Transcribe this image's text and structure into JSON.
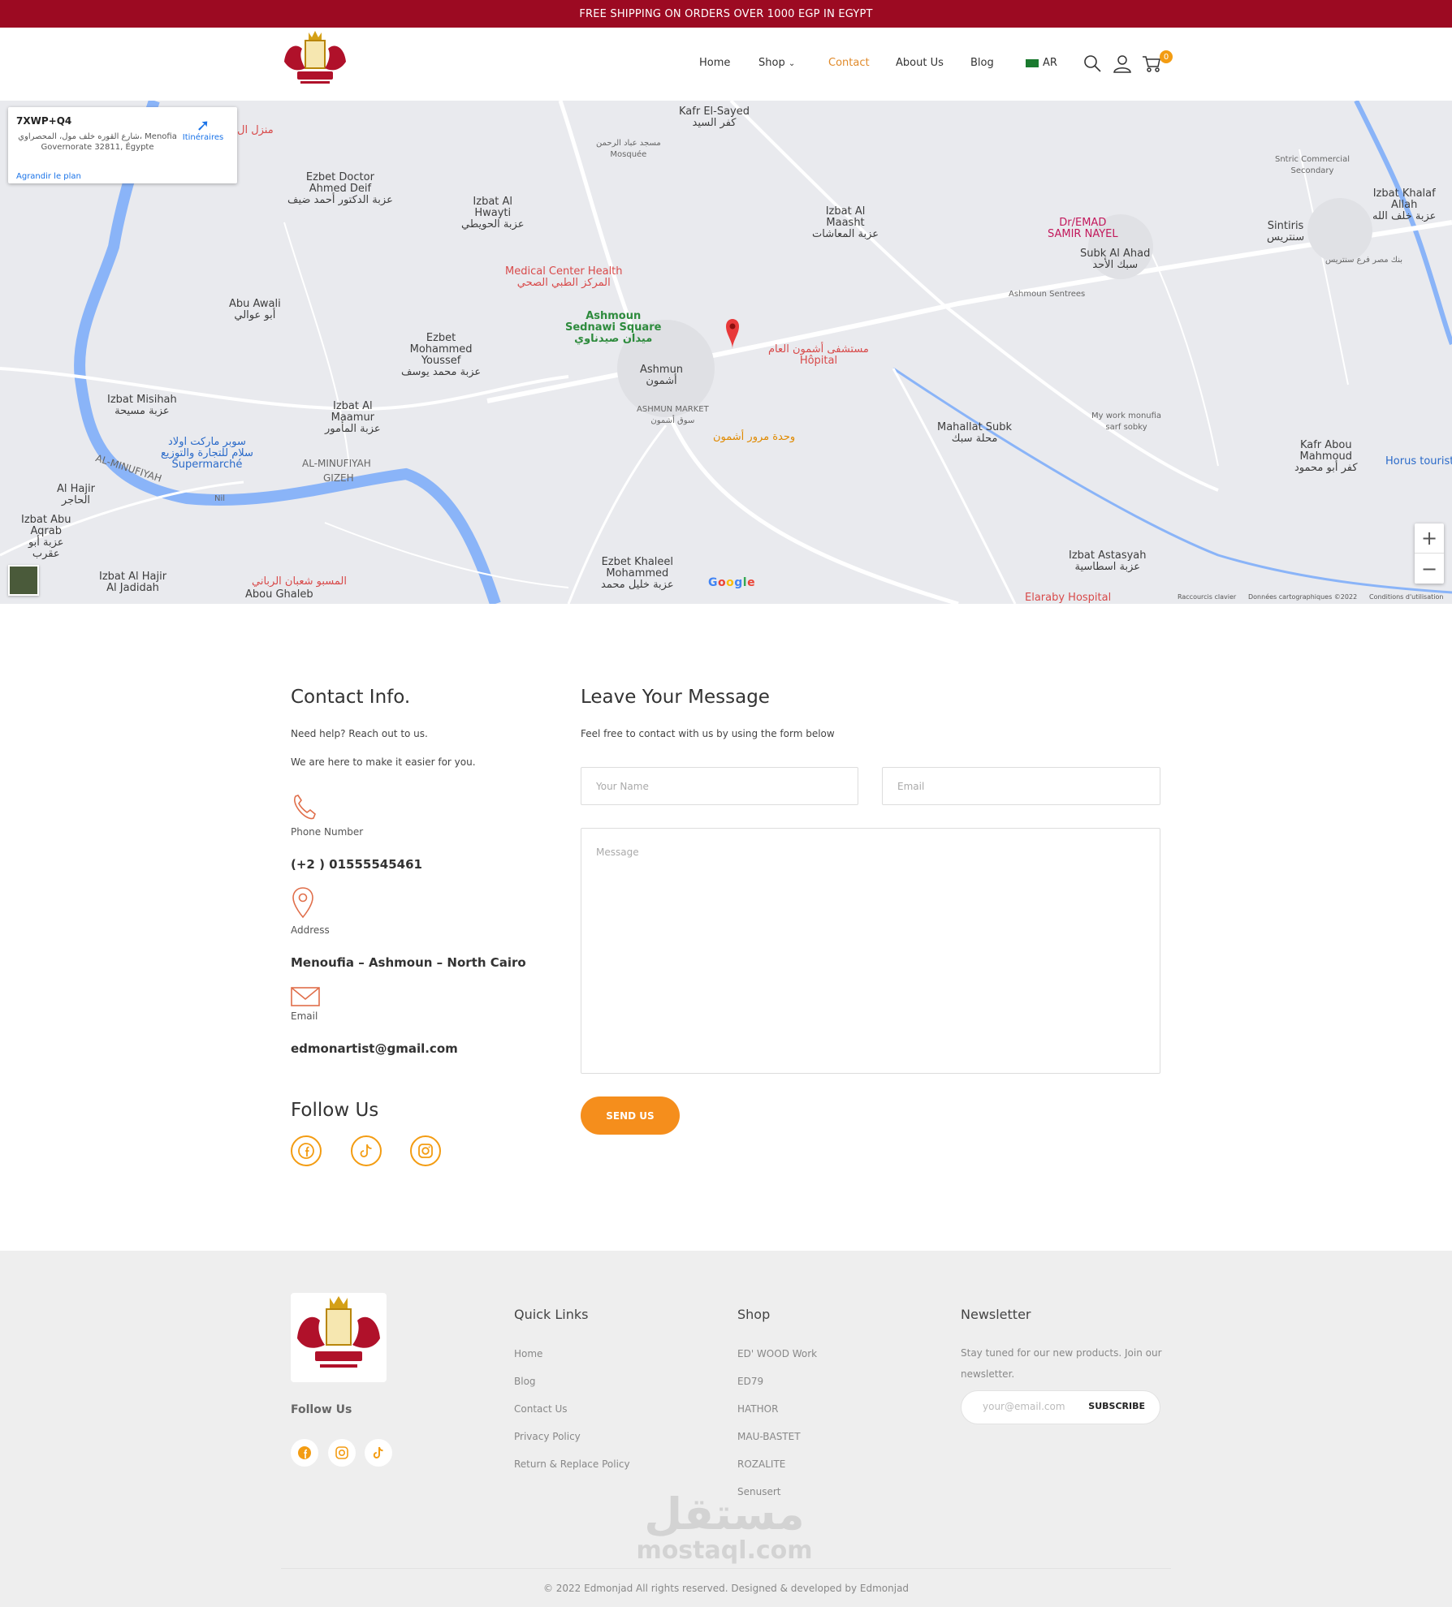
{
  "topbar": {
    "text": "FREE SHIPPING ON ORDERS OVER 1000 EGP IN EGYPT"
  },
  "brand": {
    "accent": "#f39c12",
    "primary": "#9c0a22"
  },
  "nav": {
    "home": "Home",
    "shop": "Shop",
    "contact": "Contact",
    "about": "About Us",
    "blog": "Blog",
    "lang": "AR",
    "cart_count": "0"
  },
  "map": {
    "plus_code": "7XWP+Q4",
    "address": "شارع القوره خلف مول، المحصراوي، Menofia Governorate 32811, Égypte",
    "directions": "Itinéraires",
    "enlarge": "Agrandir le plan",
    "shortcuts": "Raccourcis clavier",
    "mapdata": "Données cartographiques ©2022",
    "terms": "Conditions d'utilisation",
    "labels": {
      "kafr_sayed": "Kafr El-Sayed",
      "kafr_sayed_ar": "كفر السيد",
      "mosque": "مسجد عباد الرحمن",
      "mosque_sub": "Mosquée",
      "ezbet_doctor": "Ezbet Doctor Ahmed Deif",
      "ezbet_doctor_ar": "عزبة الدكتور أحمد ضيف",
      "hwayti": "Izbat Al Hwayti",
      "hwayti_ar": "عزبة الحويطي",
      "maasht": "Izbat Al Maasht",
      "maasht_ar": "عزبة المعاشات",
      "medical": "Medical Center Health",
      "medical_ar": "المركز الطبي الصحي",
      "ashmoun_sq": "Ashmoun Sednawi Square",
      "ashmoun_sq_ar": "ميدان صيدناوي",
      "ashmun": "Ashmun",
      "ashmun_ar": "أشمون",
      "hospital_ar": "مستشفى أشمون العام",
      "hospital_sub": "Hôpital",
      "abu_awali": "Abu Awali",
      "abu_awali_ar": "أبو عوالي",
      "ezbet_mohammed": "Ezbet Mohammed Youssef",
      "ezbet_mohammed_ar": "عزبة محمد يوسف",
      "misihah": "Izbat Misihah",
      "misihah_ar": "عزبة مسيحة",
      "maamur": "Izbat Al Maamur",
      "maamur_ar": "عزبة المأمور",
      "market": "ASHMUN MARKET",
      "market_ar": "سوق أشمون",
      "traffic_ar": "وحدة مرور أشمون",
      "mahallat": "Mahallat Subk",
      "mahallat_ar": "محلة سبك",
      "supermarket_ar": "سوبر ماركت اولاد سلام للتجارة والتوزيع",
      "supermarket_sub": "Supermarché",
      "minufiyah": "AL-MINUFIYAH",
      "gizeh": "GIZEH",
      "nil": "Nil",
      "hajir": "Al Hajir",
      "hajir_ar": "الحاجر",
      "abu_aqrab": "Izbat Abu Aqrab",
      "abu_aqrab_ar": "عزبة أبو عقرب",
      "hajir_jadidah": "Izbat Al Hajir Al Jadidah",
      "abou_ghaleb": "Abou Ghaleb",
      "abou_ghaleb_ar": "المسبو شعبان الرباني",
      "khaleel": "Ezbet Khaleel Mohammed",
      "khaleel_ar": "عزبة خليل محمد",
      "astasyah": "Izbat Astasyah",
      "astasyah_ar": "عزبة اسطاسية",
      "elaraby": "Elaraby Hospital",
      "samir": "Dr/EMAD SAMIR NAYEL",
      "subk": "Subk Al Ahad",
      "subk_ar": "سبك الأحد",
      "sintiris": "Sintiris",
      "sintiris_ar": "سنتريس",
      "sntric": "Sntric Commercial Secondary",
      "khalaf": "Izbat Khalaf Allah",
      "khalaf_ar": "عزبة خلف الله",
      "work": "My work monufia sarf sobky",
      "kafr_abou": "Kafr Abou Mahmoud",
      "kafr_abou_ar": "كفر أبو محمود",
      "horus": "Horus tourist",
      "sentrees": "Ashmoun Sentrees",
      "bank_ar": "بنك مصر فرع سنتريس",
      "manzil_ar": "منزل ال"
    }
  },
  "contact_info": {
    "title": "Contact Info.",
    "line1": "Need help? Reach out to us.",
    "line2": "We are here to make it easier for you.",
    "phone_label": "Phone Number",
    "phone": "(+2 ) 01555545461",
    "address_label": "Address",
    "address": "Menoufia – Ashmoun – North Cairo",
    "email_label": "Email",
    "email": "edmonartist@gmail.com",
    "follow": "Follow Us"
  },
  "message_form": {
    "title": "Leave Your Message",
    "subtitle": "Feel free to contact with us by using the form below",
    "name_placeholder": "Your Name",
    "email_placeholder": "Email",
    "message_placeholder": "Message",
    "send": "SEND US"
  },
  "footer": {
    "follow": "Follow Us",
    "quick_links_title": "Quick Links",
    "quick_links": [
      "Home",
      "Blog",
      "Contact Us",
      "Privacy Policy",
      "Return & Replace Policy"
    ],
    "shop_title": "Shop",
    "shop_links": [
      "ED' WOOD Work",
      "ED79",
      "HATHOR",
      "MAU-BASTET",
      "ROZALITE",
      "Senusert"
    ],
    "newsletter_title": "Newsletter",
    "newsletter_text": "Stay tuned for our new products. Join our newsletter.",
    "newsletter_placeholder": "your@email.com",
    "subscribe": "SUBSCRIBE",
    "watermark_ar": "مستقل",
    "watermark_lat": "mostaql.com",
    "copyright": "© 2022 Edmonjad All rights reserved. Designed & developed by Edmonjad"
  }
}
